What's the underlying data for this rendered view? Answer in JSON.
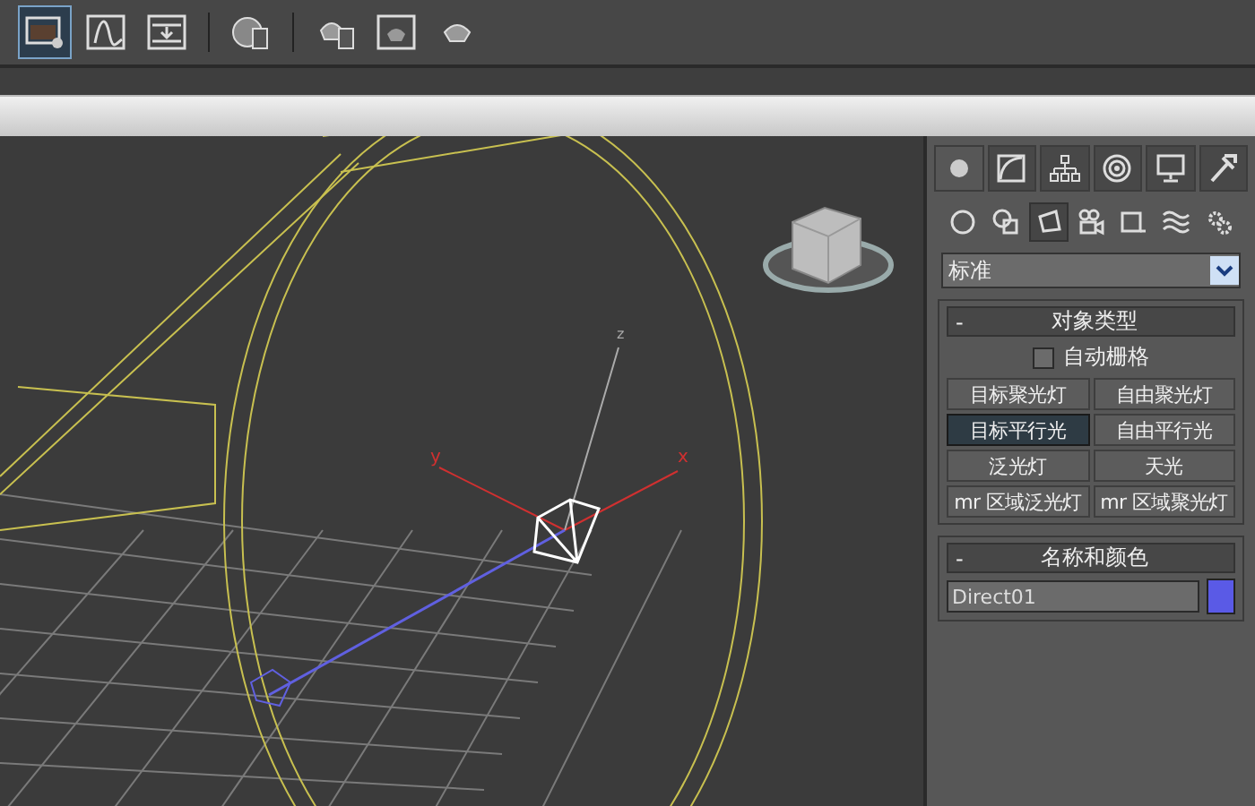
{
  "toolbar": {
    "buttons": [
      {
        "selected": true
      },
      {
        "selected": false
      },
      {
        "selected": false
      },
      {
        "selected": false
      },
      {
        "selected": false
      },
      {
        "selected": false
      },
      {
        "selected": false
      }
    ]
  },
  "viewport": {
    "axis_labels": [
      "y",
      "x",
      "z"
    ]
  },
  "command_panel": {
    "tabs": [
      {
        "selected": true
      },
      {
        "selected": false
      },
      {
        "selected": false
      },
      {
        "selected": false
      },
      {
        "selected": false
      },
      {
        "selected": false
      }
    ],
    "categories": [
      {
        "selected": false
      },
      {
        "selected": false
      },
      {
        "selected": true
      },
      {
        "selected": false
      },
      {
        "selected": false
      },
      {
        "selected": false
      },
      {
        "selected": false
      }
    ],
    "dropdown": {
      "value": "标准"
    },
    "object_type": {
      "toggle": "-",
      "title": "对象类型",
      "auto_grid": {
        "label": "自动栅格",
        "checked": false
      },
      "buttons": [
        {
          "label": "目标聚光灯",
          "selected": false
        },
        {
          "label": "自由聚光灯",
          "selected": false
        },
        {
          "label": "目标平行光",
          "selected": true
        },
        {
          "label": "自由平行光",
          "selected": false
        },
        {
          "label": "泛光灯",
          "selected": false
        },
        {
          "label": "天光",
          "selected": false
        },
        {
          "label": "mr 区域泛光灯",
          "selected": false
        },
        {
          "label": "mr 区域聚光灯",
          "selected": false
        }
      ]
    },
    "name_and_color": {
      "toggle": "-",
      "title": "名称和颜色",
      "name": "Direct01",
      "color": "#5a5ae6"
    }
  }
}
